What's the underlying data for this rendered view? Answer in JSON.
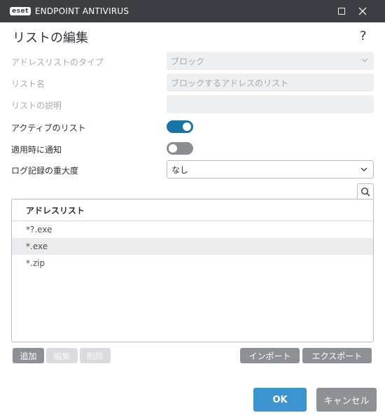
{
  "window": {
    "logo_badge": "eset",
    "app_title": "ENDPOINT ANTIVIRUS"
  },
  "dialog": {
    "title": "リストの編集",
    "help": "?"
  },
  "form": {
    "address_list_type": {
      "label": "アドレスリストのタイプ",
      "value": "ブロック",
      "enabled": false
    },
    "list_name": {
      "label": "リスト名",
      "value": "ブロックするアドレスのリスト",
      "enabled": false
    },
    "list_description": {
      "label": "リストの説明",
      "value": "",
      "enabled": false
    },
    "active_list": {
      "label": "アクティブのリスト",
      "on": true
    },
    "notify_on_apply": {
      "label": "適用時に通知",
      "on": false
    },
    "log_severity": {
      "label": "ログ記録の重大度",
      "value": "なし"
    }
  },
  "address_list": {
    "header": "アドレスリスト",
    "items": [
      "*?.exe",
      "*.exe",
      "*.zip"
    ],
    "selected_index": 1
  },
  "buttons": {
    "add": "追加",
    "edit": "編集",
    "delete": "削除",
    "import": "インポート",
    "export": "エクスポート",
    "ok": "OK",
    "cancel": "キャンセル"
  },
  "colors": {
    "titlebar": "#3b3f44",
    "toggle_on": "#1a73a5",
    "ok_button": "#3d95cf",
    "secondary_button": "#8d9196"
  }
}
